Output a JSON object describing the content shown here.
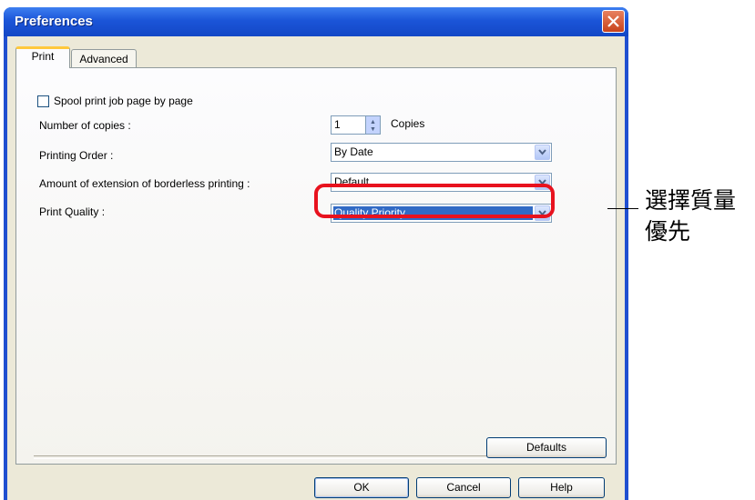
{
  "window": {
    "title": "Preferences"
  },
  "tabs": [
    {
      "label": "Print"
    },
    {
      "label": "Advanced"
    }
  ],
  "print_tab": {
    "spool": {
      "label": "Spool print job page by page",
      "checked": false
    },
    "copies": {
      "label": "Number of copies :",
      "value": "1",
      "unit": "Copies"
    },
    "order": {
      "label": "Printing Order :",
      "value": "By Date"
    },
    "borderless": {
      "label": "Amount of extension of borderless printing :",
      "value": "Default"
    },
    "quality": {
      "label": "Print Quality :",
      "value": "Quality Priority"
    },
    "defaults_button": "Defaults"
  },
  "footer": {
    "ok": "OK",
    "cancel": "Cancel",
    "help": "Help"
  },
  "annotation": {
    "line1": "選擇質量",
    "line2": "優先",
    "highlight_color": "#e8121e"
  },
  "icons": [
    "close-icon",
    "spin-up-icon",
    "spin-down-icon",
    "chevron-down-icon"
  ]
}
